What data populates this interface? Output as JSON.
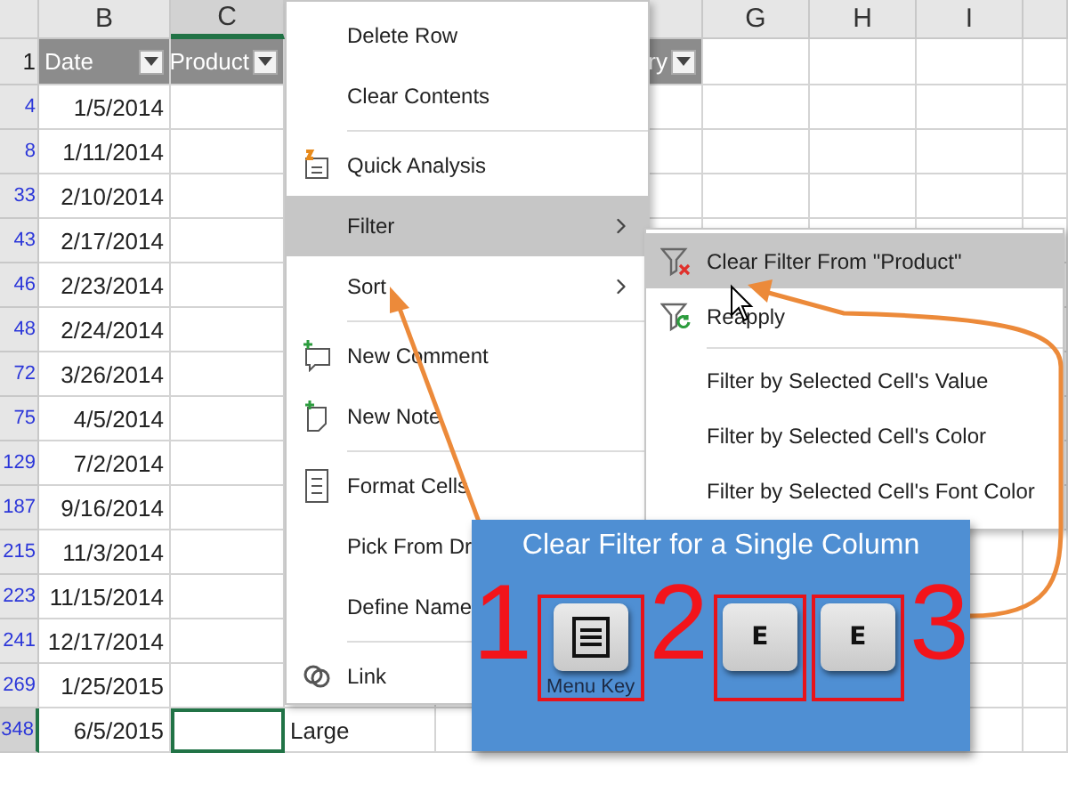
{
  "sheet": {
    "columns": [
      {
        "label": "B",
        "selected": false
      },
      {
        "label": "C",
        "selected": true
      },
      {
        "label": "G",
        "selected": false
      },
      {
        "label": "H",
        "selected": false
      },
      {
        "label": "I",
        "selected": false
      }
    ],
    "header_row": {
      "number": "1",
      "cells": [
        "Date",
        "Product",
        "ry"
      ]
    },
    "rows": [
      {
        "number": "4",
        "date": "1/5/2014",
        "selected": false
      },
      {
        "number": "8",
        "date": "1/11/2014",
        "selected": false
      },
      {
        "number": "33",
        "date": "2/10/2014",
        "selected": false
      },
      {
        "number": "43",
        "date": "2/17/2014",
        "selected": false
      },
      {
        "number": "46",
        "date": "2/23/2014",
        "selected": false
      },
      {
        "number": "48",
        "date": "2/24/2014",
        "selected": false
      },
      {
        "number": "72",
        "date": "3/26/2014",
        "selected": false
      },
      {
        "number": "75",
        "date": "4/5/2014",
        "selected": false
      },
      {
        "number": "129",
        "date": "7/2/2014",
        "selected": false
      },
      {
        "number": "187",
        "date": "9/16/2014",
        "selected": false
      },
      {
        "number": "215",
        "date": "11/3/2014",
        "selected": false
      },
      {
        "number": "223",
        "date": "11/15/2014",
        "selected": false
      },
      {
        "number": "241",
        "date": "12/17/2014",
        "selected": false
      },
      {
        "number": "269",
        "date": "1/25/2015",
        "selected": false
      },
      {
        "number": "348",
        "date": "6/5/2015",
        "selected": true,
        "extra": "Large"
      }
    ]
  },
  "context_menu": {
    "groups": [
      [
        {
          "label": "Delete Row",
          "selected": false,
          "submenu": false
        },
        {
          "label": "Clear Contents",
          "selected": false,
          "submenu": false
        }
      ],
      [
        {
          "label": "Quick Analysis",
          "selected": false,
          "submenu": false
        },
        {
          "label": "Filter",
          "selected": true,
          "submenu": true
        },
        {
          "label": "Sort",
          "selected": false,
          "submenu": true
        }
      ],
      [
        {
          "label": "New Comment",
          "selected": false,
          "submenu": false
        },
        {
          "label": "New Note",
          "selected": false,
          "submenu": false
        }
      ],
      [
        {
          "label": "Format Cells",
          "selected": false,
          "submenu": false
        },
        {
          "label": "Pick From Dr",
          "selected": false
        },
        {
          "label": "Define Name",
          "selected": false
        }
      ],
      [
        {
          "label": "Link",
          "selected": false
        }
      ]
    ]
  },
  "submenu": {
    "groups": [
      [
        {
          "label": "Clear Filter From \"Product\"",
          "selected": true
        },
        {
          "label": "Reapply",
          "selected": false
        }
      ],
      [
        {
          "label": "Filter by Selected Cell's Value",
          "selected": false
        },
        {
          "label": "Filter by Selected Cell's Color",
          "selected": false
        },
        {
          "label": "Filter by Selected Cell's Font Color",
          "selected": false
        }
      ]
    ]
  },
  "tip_panel": {
    "title": "Clear Filter for a Single Column",
    "keys": [
      {
        "kind": "menu",
        "caption": "Menu Key"
      },
      {
        "kind": "letter",
        "label": "E"
      },
      {
        "kind": "letter",
        "label": "E"
      }
    ],
    "step_numbers": [
      "1",
      "2",
      "3"
    ]
  }
}
